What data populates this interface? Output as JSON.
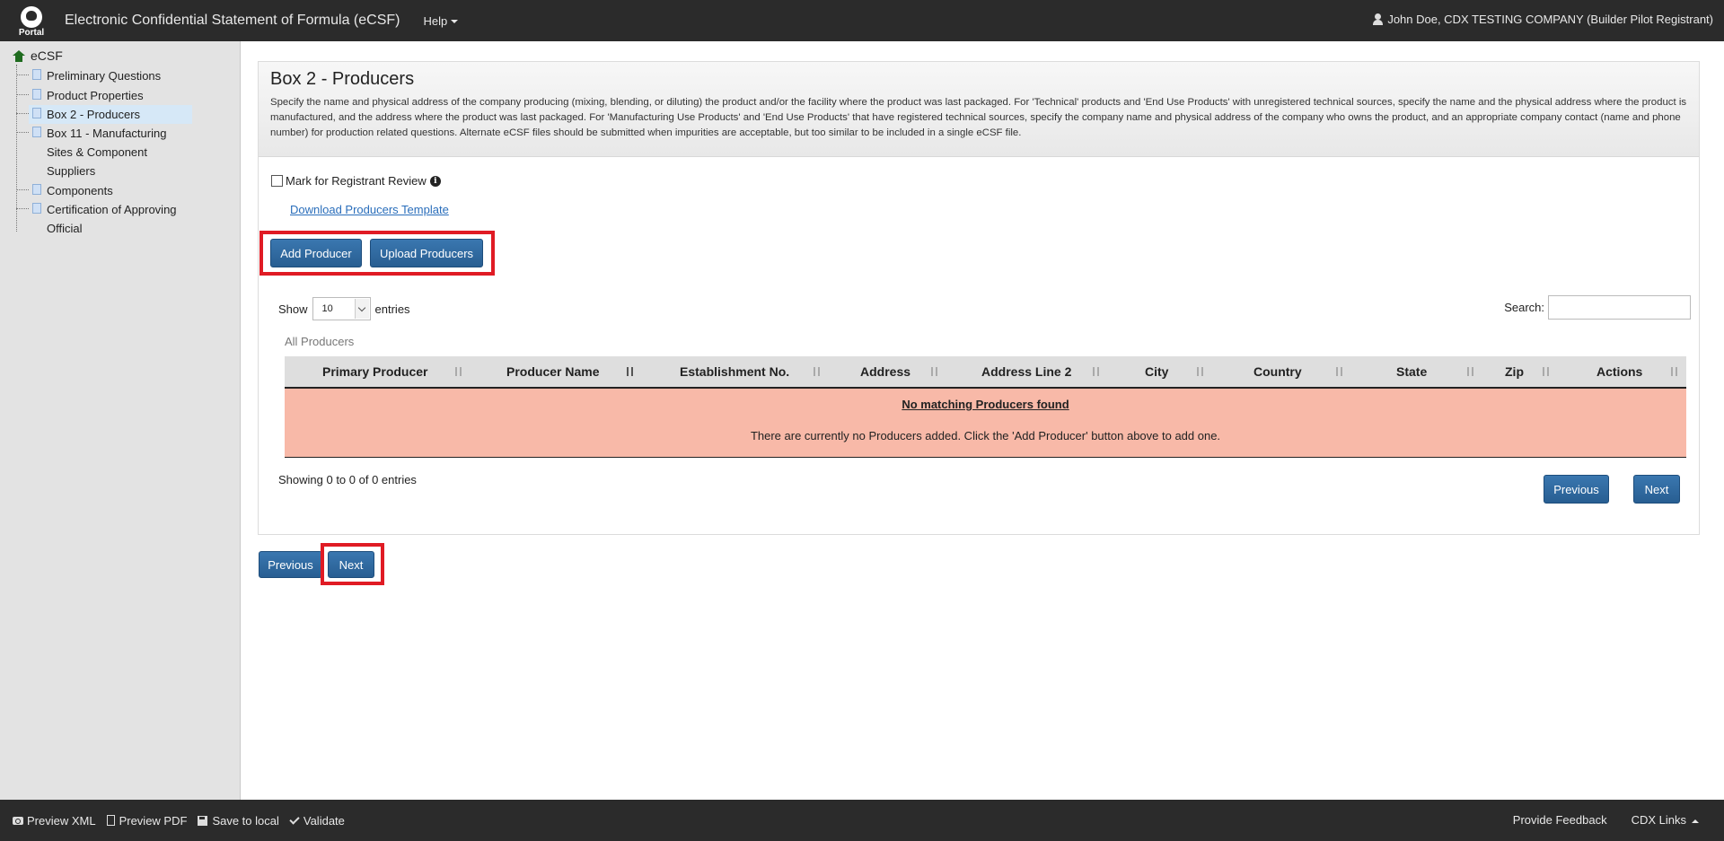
{
  "header": {
    "logo_text": "Portal",
    "app_title": "Electronic Confidential Statement of Formula (eCSF)",
    "help_label": "Help",
    "user_label": "John Doe, CDX TESTING COMPANY (Builder Pilot Registrant)"
  },
  "sidebar": {
    "root": "eCSF",
    "items": [
      {
        "label": "Preliminary Questions"
      },
      {
        "label": "Product Properties"
      },
      {
        "label": "Box 2 - Producers"
      },
      {
        "label_line1": "Box 11 - Manufacturing",
        "label_line2": "Sites & Component",
        "label_line3": "Suppliers"
      },
      {
        "label": "Components"
      },
      {
        "label_line1": "Certification of Approving",
        "label_line2": "Official"
      }
    ]
  },
  "panel": {
    "title": "Box 2 - Producers",
    "description": "Specify the name and physical address of the company producing (mixing, blending, or diluting) the product and/or the facility where the product was last packaged. For 'Technical' products and 'End Use Products' with unregistered technical sources, specify the name and the physical address where the product is manufactured, and the address where the product was last packaged. For 'Manufacturing Use Products' and 'End Use Products' that have registered technical sources, specify the company name and physical address of the company who owns the product, and an appropriate company contact (name and phone number) for production related questions. Alternate eCSF files should be submitted when impurities are acceptable, but too similar to be included in a single eCSF file.",
    "mark_review_label": "Mark for Registrant Review",
    "download_link": "Download Producers Template",
    "add_button": "Add Producer",
    "upload_button": "Upload Producers"
  },
  "table": {
    "show_label": "Show",
    "page_size": "10",
    "entries_label": "entries",
    "search_label": "Search:",
    "caption": "All Producers",
    "columns": [
      "Primary Producer",
      "Producer Name",
      "Establishment No.",
      "Address",
      "Address Line 2",
      "City",
      "Country",
      "State",
      "Zip",
      "Actions"
    ],
    "empty_title": "No matching Producers found",
    "empty_message": "There are currently no Producers added. Click the 'Add Producer' button above to add one.",
    "showing_text": "Showing 0 to 0 of 0 entries",
    "prev_label": "Previous",
    "next_label": "Next"
  },
  "nav": {
    "prev_label": "Previous",
    "next_label": "Next"
  },
  "footer": {
    "preview_xml": "Preview XML",
    "preview_pdf": "Preview PDF",
    "save_local": "Save to local",
    "validate": "Validate",
    "feedback": "Provide Feedback",
    "cdx_links": "CDX Links"
  },
  "colors": {
    "header_bg": "#2b2b2b",
    "button_primary": "#285e92",
    "empty_row_bg": "#f8b9a8",
    "highlight": "#e01b24"
  }
}
